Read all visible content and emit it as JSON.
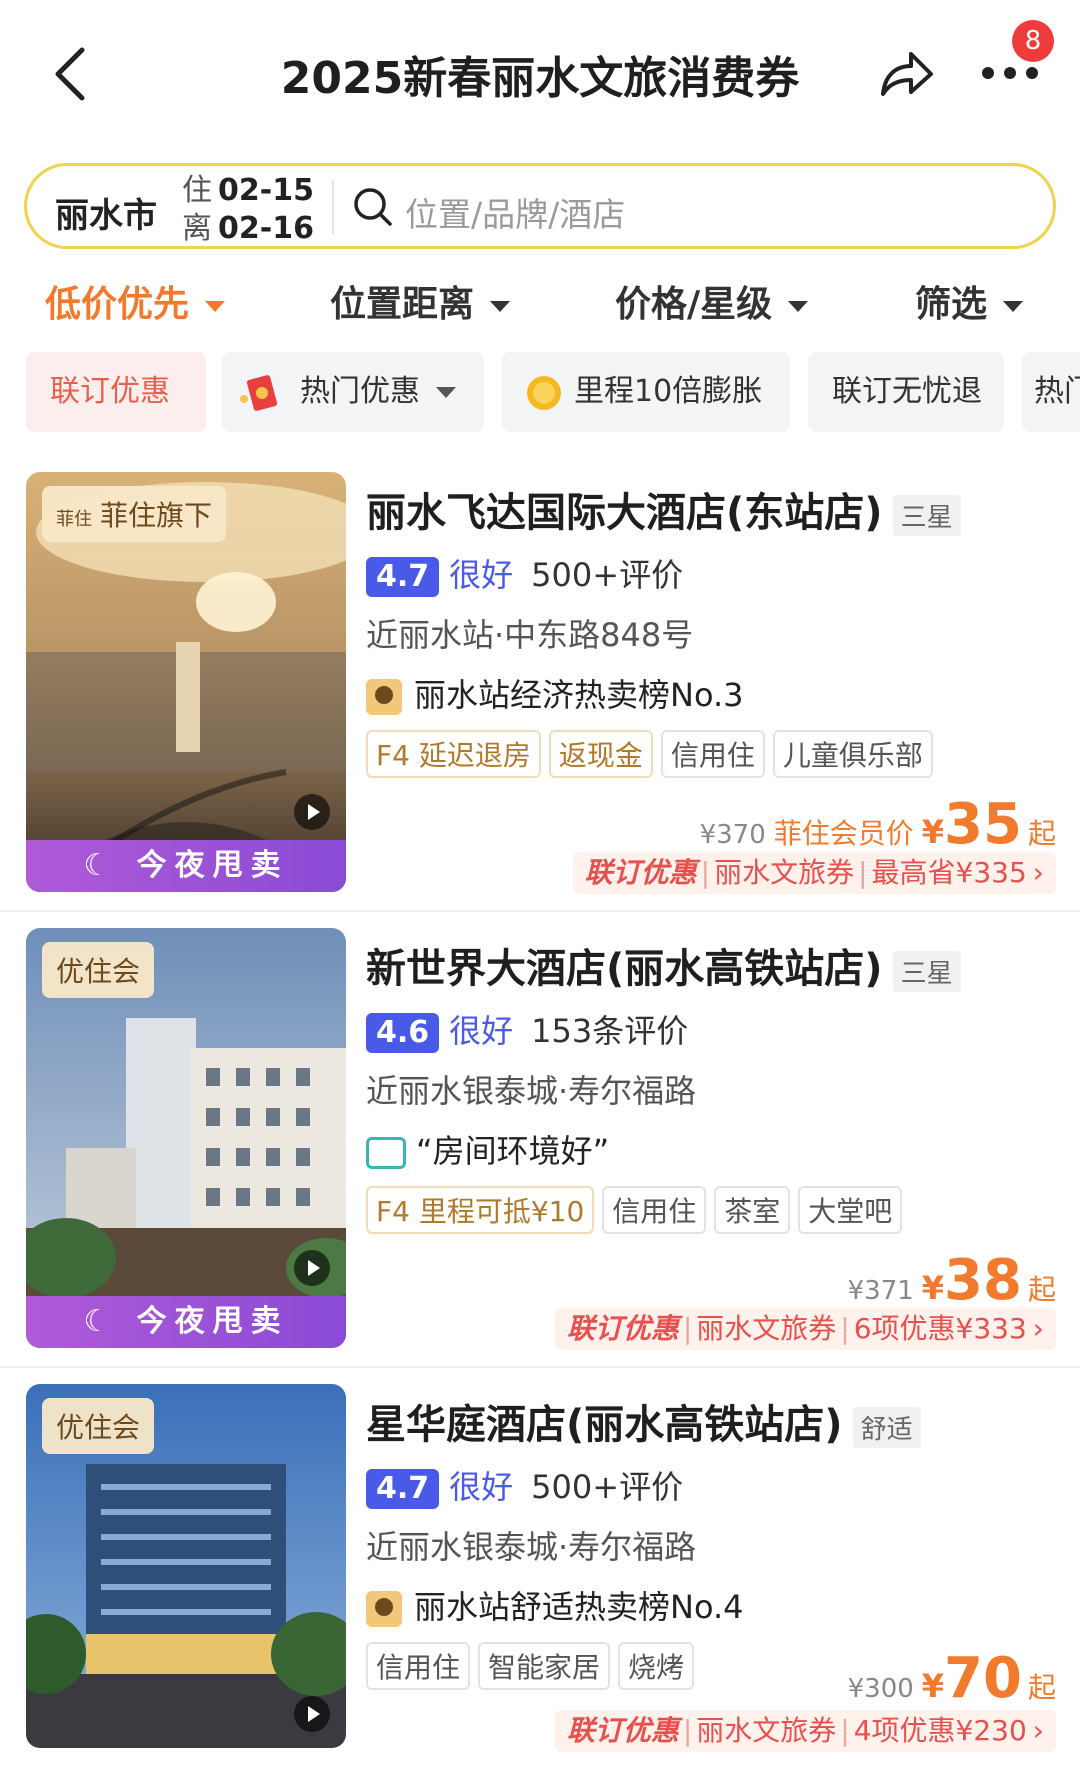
{
  "header": {
    "title": "2025新春丽水文旅消费券",
    "badge_count": "8"
  },
  "search": {
    "city": "丽水市",
    "checkin_label": "住",
    "checkin_date": "02-15",
    "checkout_label": "离",
    "checkout_date": "02-16",
    "placeholder": "位置/品牌/酒店"
  },
  "sort_tabs": [
    {
      "label": "低价优先",
      "active": true
    },
    {
      "label": "位置距离",
      "active": false
    },
    {
      "label": "价格/星级",
      "active": false
    },
    {
      "label": "筛选",
      "active": false
    }
  ],
  "chips": [
    "联订优惠",
    "热门优惠",
    "里程10倍膨胀",
    "联订无忧退",
    "热门"
  ],
  "hotels": [
    {
      "badge_small": "菲住",
      "badge": "菲住旗下",
      "tonight": "今夜甩卖",
      "name": "丽水飞达国际大酒店(东站店)",
      "star": "三星",
      "score": "4.7",
      "score_word": "很好",
      "reviews": "500+评价",
      "address": "近丽水站·中东路848号",
      "highlight": "丽水站经济热卖榜No.3",
      "tags": [
        "F4 延迟退房",
        "返现金",
        "信用住",
        "儿童俱乐部"
      ],
      "orig_price": "¥370",
      "member_label": "菲住会员价",
      "currency": "¥",
      "price": "35",
      "price_suffix": "起",
      "promo": [
        "联订优惠",
        "丽水文旅券",
        "最高省¥335"
      ]
    },
    {
      "badge": "优住会",
      "tonight": "今夜甩卖",
      "name": "新世界大酒店(丽水高铁站店)",
      "star": "三星",
      "score": "4.6",
      "score_word": "很好",
      "reviews": "153条评价",
      "address": "近丽水银泰城·寿尔福路",
      "highlight": "“房间环境好”",
      "tags": [
        "F4 里程可抵¥10",
        "信用住",
        "茶室",
        "大堂吧"
      ],
      "orig_price": "¥371",
      "currency": "¥",
      "price": "38",
      "price_suffix": "起",
      "promo": [
        "联订优惠",
        "丽水文旅券",
        "6项优惠¥333"
      ]
    },
    {
      "badge": "优住会",
      "name": "星华庭酒店(丽水高铁站店)",
      "star": "舒适",
      "score": "4.7",
      "score_word": "很好",
      "reviews": "500+评价",
      "address": "近丽水银泰城·寿尔福路",
      "highlight": "丽水站舒适热卖榜No.4",
      "tags": [
        "信用住",
        "智能家居",
        "烧烤"
      ],
      "orig_price": "¥300",
      "currency": "¥",
      "price": "70",
      "price_suffix": "起",
      "promo": [
        "联订优惠",
        "丽水文旅券",
        "4项优惠¥230"
      ]
    }
  ],
  "colors": {
    "accent_orange": "#f27a2c",
    "rating_blue": "#4a5ae8",
    "promo_red": "#e8504d",
    "search_border": "#f1d24a"
  }
}
